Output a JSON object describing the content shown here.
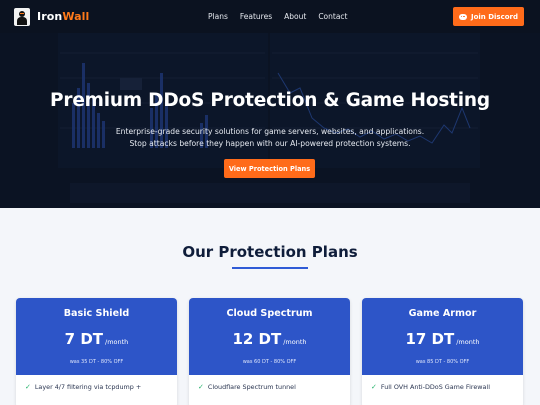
{
  "nav": {
    "brand_part1": "Iron",
    "brand_part2": "Wall",
    "links": [
      "Plans",
      "Features",
      "About",
      "Contact"
    ],
    "cta": "Join Discord"
  },
  "hero": {
    "title": "Premium DDoS Protection & Game Hosting",
    "subtitle_line1": "Enterprise-grade security solutions for game servers, websites, and applications.",
    "subtitle_line2": "Stop attacks before they happen with our AI-powered protection systems.",
    "button": "View Protection Plans"
  },
  "plans_section": {
    "title": "Our Protection Plans",
    "plans": [
      {
        "name": "Basic Shield",
        "price": "7 DT",
        "period": "/month",
        "was": "was 35 DT - 80% OFF",
        "feature": "Layer 4/7 filtering via tcpdump +"
      },
      {
        "name": "Cloud Spectrum",
        "price": "12 DT",
        "period": "/month",
        "was": "was 60 DT - 80% OFF",
        "feature": "Cloudflare Spectrum tunnel"
      },
      {
        "name": "Game Armor",
        "price": "17 DT",
        "period": "/month",
        "was": "was 85 DT - 80% OFF",
        "feature": "Full OVH Anti-DDoS Game Firewall"
      }
    ]
  },
  "colors": {
    "accent": "#ff6b1a",
    "nav_bg": "#0b1220",
    "card_header": "#2d55c8",
    "check": "#26b36b"
  }
}
